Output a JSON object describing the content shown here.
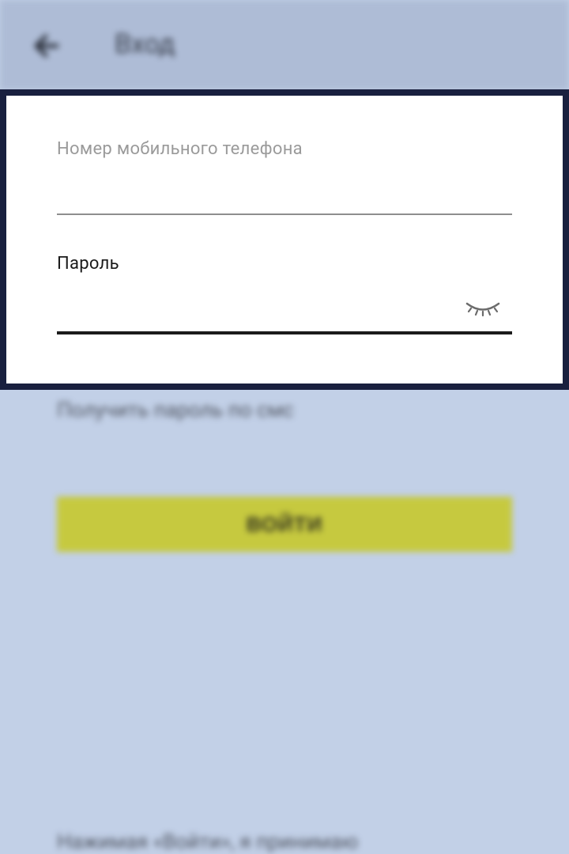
{
  "topbar": {
    "title": "Вход",
    "back_icon": "arrow-left-icon"
  },
  "form": {
    "phone_label": "Номер мобильного телефона",
    "phone_value": "",
    "password_label": "Пароль",
    "password_value": "",
    "password_toggle_icon": "eye-closed-icon"
  },
  "links": {
    "sms_password": "Получить пароль по смс"
  },
  "buttons": {
    "login_label": "ВОЙТИ"
  },
  "footer": {
    "text": "Нажимая «Войти», я принимаю"
  },
  "colors": {
    "overlay_bg": "#c2d0e7",
    "topbar_bg": "#aebcd6",
    "highlight_border": "#19203f",
    "accent_button": "#c6c93f"
  }
}
